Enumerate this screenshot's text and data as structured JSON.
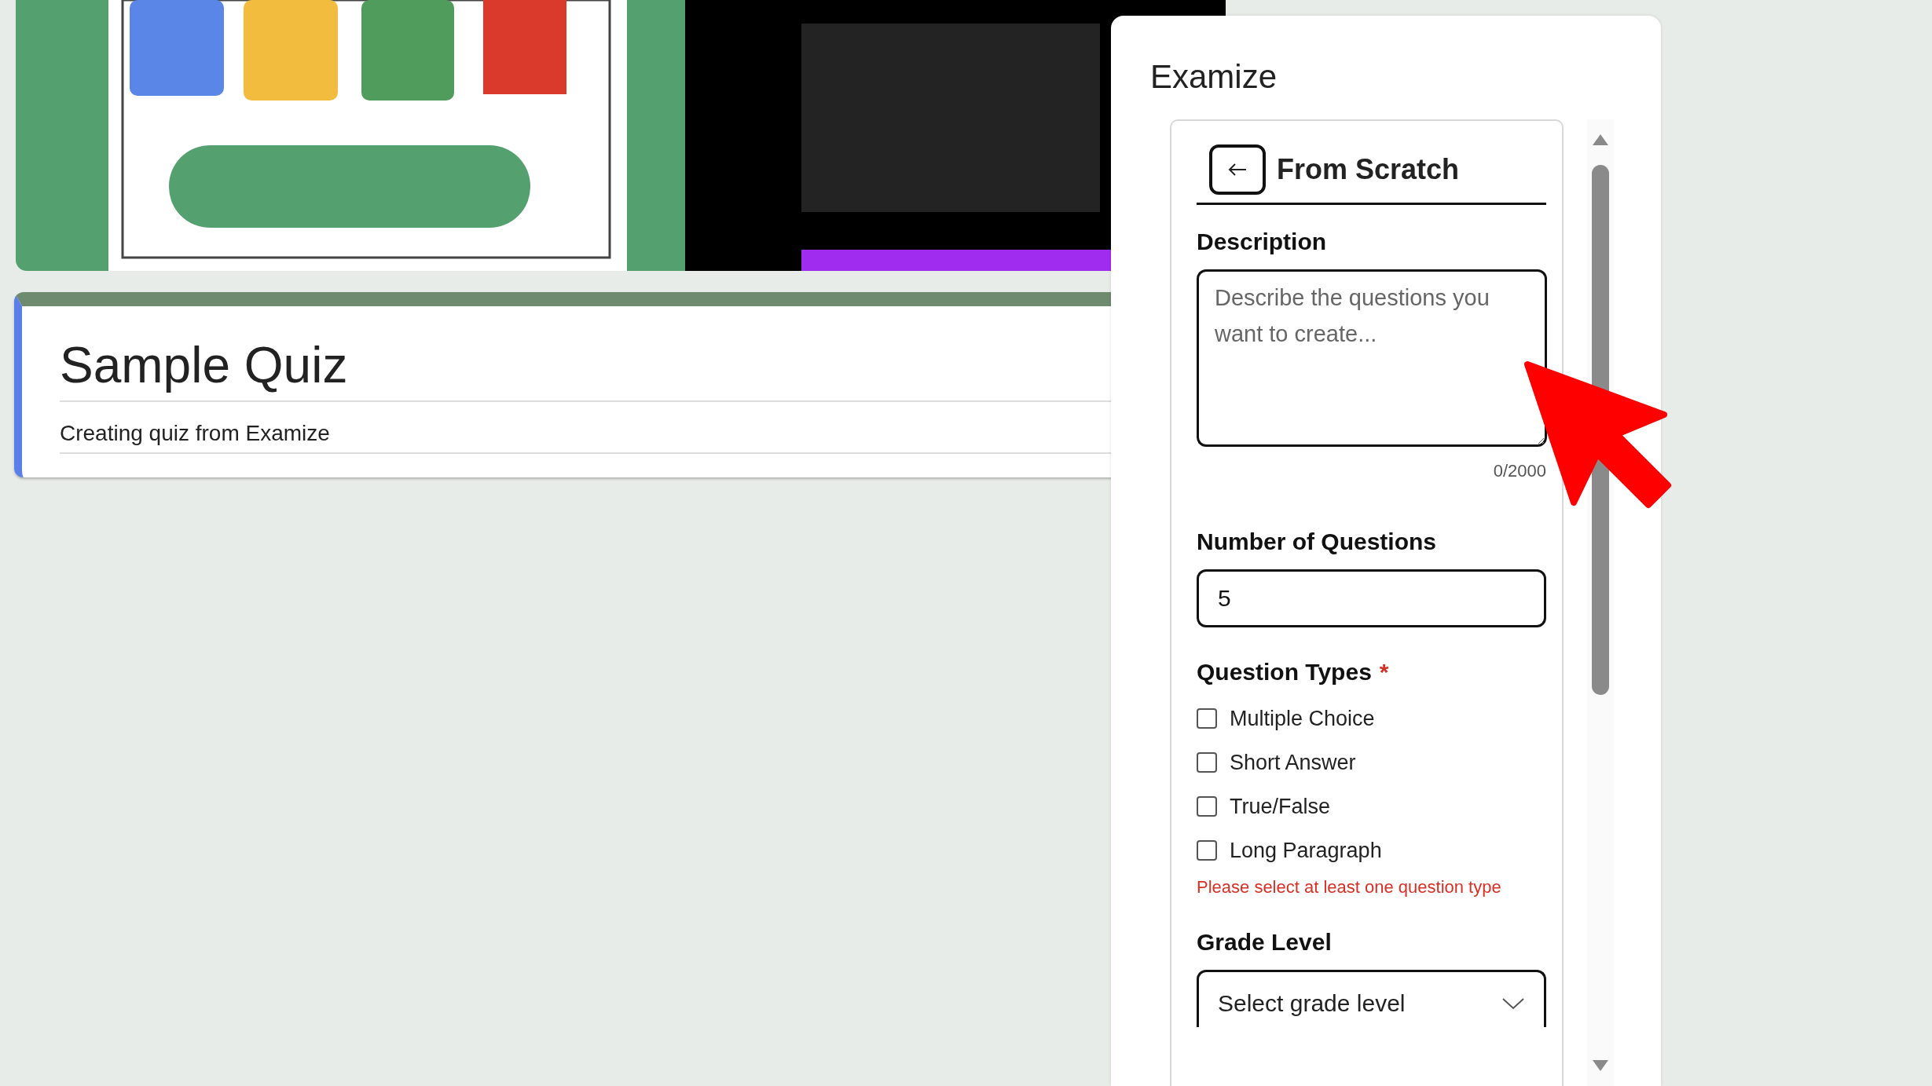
{
  "form": {
    "title": "Sample Quiz",
    "description": "Creating quiz from Examize"
  },
  "panel": {
    "title": "Examize",
    "section": "From Scratch",
    "description": {
      "label": "Description",
      "placeholder": "Describe the questions you want to create...",
      "counter": "0/2000"
    },
    "question_count": {
      "label": "Number of Questions",
      "value": "5"
    },
    "question_types": {
      "label": "Question Types",
      "required_mark": "*",
      "options": [
        {
          "label": "Multiple Choice",
          "checked": false
        },
        {
          "label": "Short Answer",
          "checked": false
        },
        {
          "label": "True/False",
          "checked": false
        },
        {
          "label": "Long Paragraph",
          "checked": false
        }
      ],
      "error": "Please select at least one question type"
    },
    "grade_level": {
      "label": "Grade Level",
      "value": "Select grade level"
    }
  }
}
